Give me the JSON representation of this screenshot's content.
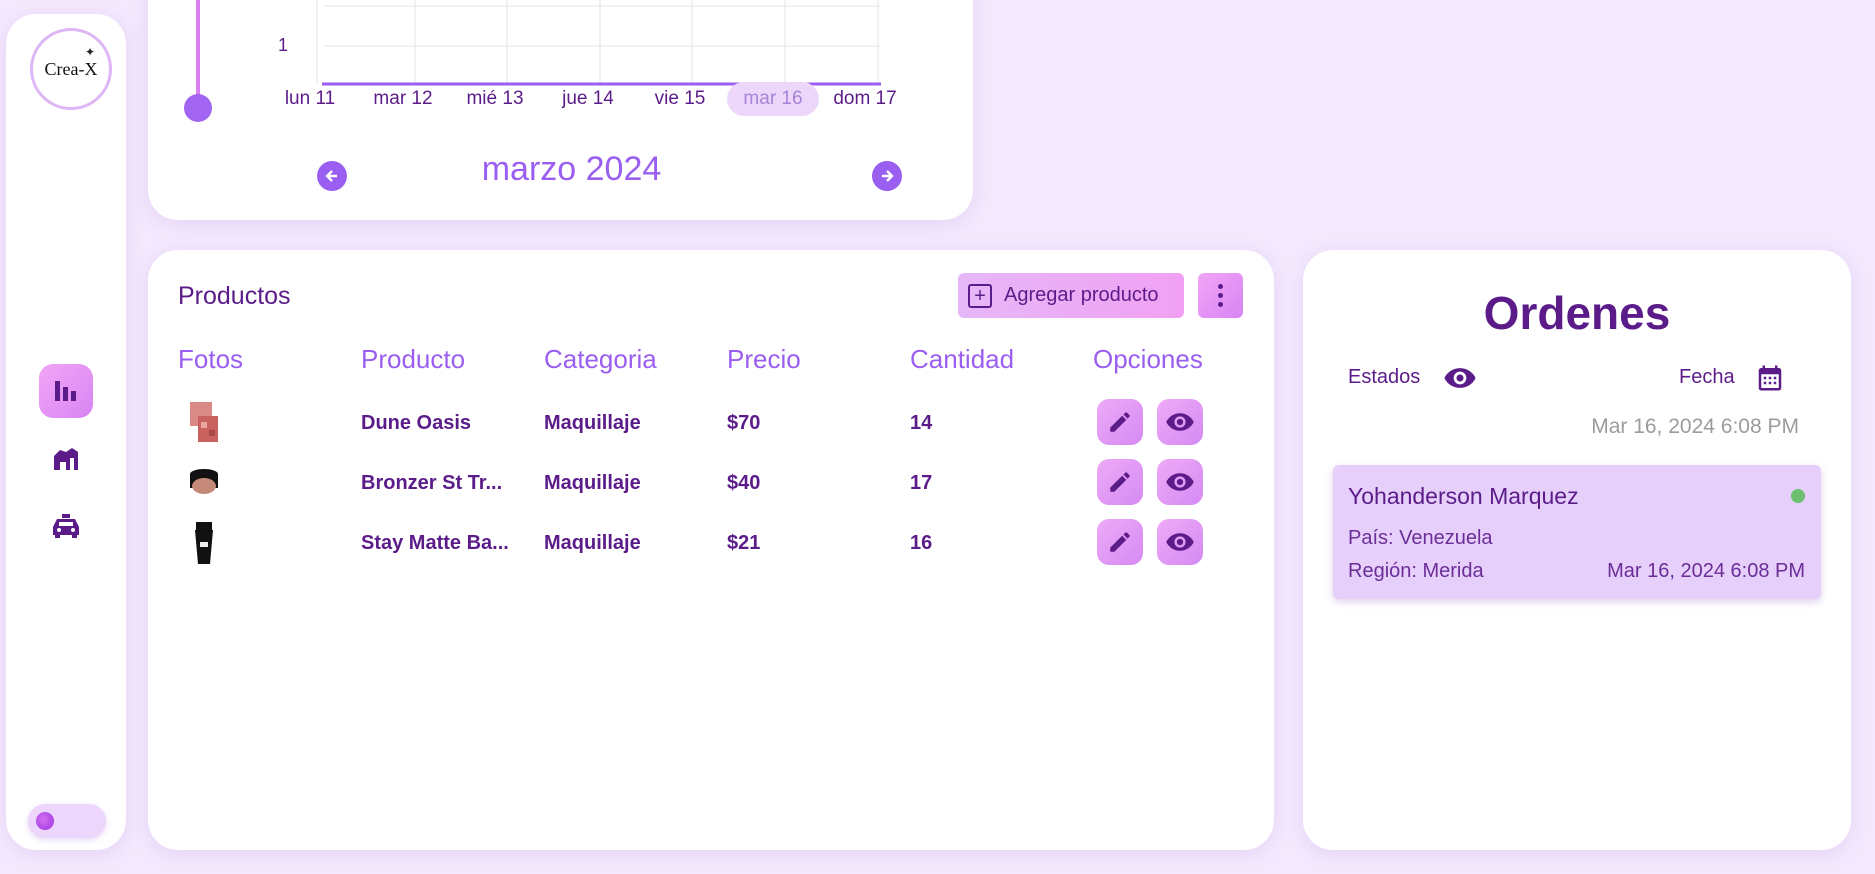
{
  "sidebar": {
    "logo_text": "Crea-X",
    "items": [
      {
        "icon": "bar-chart-icon"
      },
      {
        "icon": "store-icon"
      },
      {
        "icon": "car-icon"
      }
    ]
  },
  "chart": {
    "y_label": "1",
    "days": [
      "lun 11",
      "mar 12",
      "mié 13",
      "jue 14",
      "vie 15",
      "mar 16",
      "dom 17"
    ],
    "selected_day": "mar 16",
    "month_label": "marzo 2024"
  },
  "products": {
    "title": "Productos",
    "add_label": "Agregar producto",
    "headers": {
      "photos": "Fotos",
      "product": "Producto",
      "category": "Categoria",
      "price": "Precio",
      "quantity": "Cantidad",
      "options": "Opciones"
    },
    "rows": [
      {
        "name": "Dune Oasis",
        "category": "Maquillaje",
        "price": "$70",
        "quantity": "14"
      },
      {
        "name": "Bronzer St Tr...",
        "category": "Maquillaje",
        "price": "$40",
        "quantity": "17"
      },
      {
        "name": "Stay Matte Ba...",
        "category": "Maquillaje",
        "price": "$21",
        "quantity": "16"
      }
    ]
  },
  "orders": {
    "title": "Ordenes",
    "status_label": "Estados",
    "date_label": "Fecha",
    "current_date": "Mar 16, 2024 6:08 PM",
    "items": [
      {
        "customer": "Yohanderson Marquez",
        "country": "País: Venezuela",
        "region": "Región: Merida",
        "date": "Mar 16, 2024 6:08 PM",
        "status_color": "#6cc070"
      }
    ]
  }
}
